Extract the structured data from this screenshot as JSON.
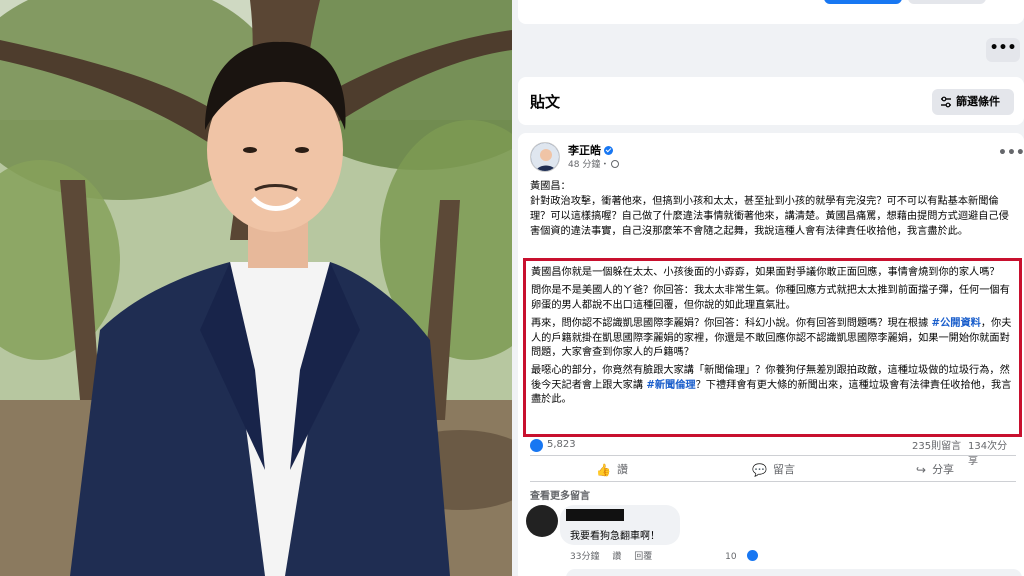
{
  "top": {
    "more_label": "•••"
  },
  "posts_section": {
    "title": "貼文",
    "filter_label": "篩選條件"
  },
  "post": {
    "author": "李正皓",
    "time": "48 分鐘・",
    "menu": "•••",
    "intro": "黃國昌：",
    "paragraph1": "針對政治攻擊，衝著他來，但搞到小孩和太太，甚至扯到小孩的就學有完沒完？可不可以有點基本新聞倫理？可以這樣搞喔？自己做了什麼違法事情就衝著他來，講清楚。黃國昌痛罵，想藉由提問方式迴避自己侵害個資的違法事實，自己沒那麼笨不會隨之起舞，我說這種人會有法律責任收拾他，我言盡於此。",
    "highlight": {
      "p1": "黃國昌你就是一個躲在太太、小孩後面的小孬孬，如果面對爭議你敢正面回應，事情會燒到你的家人嗎？",
      "p2": "問你是不是美國人的ㄚ爸？你回答：我太太非常生氣。你種回應方式就把太太推到前面擋子彈，任何一個有卵蛋的男人都說不出口這種回覆，但你說的如此理直氣壯。",
      "p3_before": "再來，問你認不認識凱思國際李麗娟？你回答：科幻小說。你有回答到問題嗎？現在根據 ",
      "p3_tag": "#公開資料",
      "p3_after": "，你夫人的戶籍就掛在凱思國際李麗娟的家裡，你還是不敢回應你認不認識凱思國際李麗娟，如果一開始你就面對問題，大家會查到你家人的戶籍嗎？",
      "p4_before": "最噁心的部分，你竟然有臉跟大家講「新聞倫理」？你養狗仔無差別跟拍政敵，這種垃圾做的垃圾行為，然後今天記者會上跟大家講 ",
      "p4_tag": "#新聞倫理",
      "p4_after": "？下禮拜會有更大條的新聞出來，這種垃圾會有法律責任收拾他，我言盡於此。"
    },
    "likes": "5,823",
    "comments": "235則留言",
    "shares": "134次分享",
    "actions": {
      "like": "讚",
      "comment": "留言",
      "share": "分享"
    }
  },
  "comments_section": {
    "more_label": "查看更多留言",
    "comment": {
      "text": "我要看狗急翻車啊！",
      "time": "33分鐘",
      "like": "讚",
      "reply": "回覆",
      "reactions": "10"
    }
  },
  "icons": {
    "like_icon": "👍",
    "comment_icon": "💬",
    "share_icon": "↪"
  },
  "colors": {
    "facebook_blue": "#1877f2",
    "highlight_red": "#c8102e",
    "hashtag_blue": "#1b5fcc"
  }
}
